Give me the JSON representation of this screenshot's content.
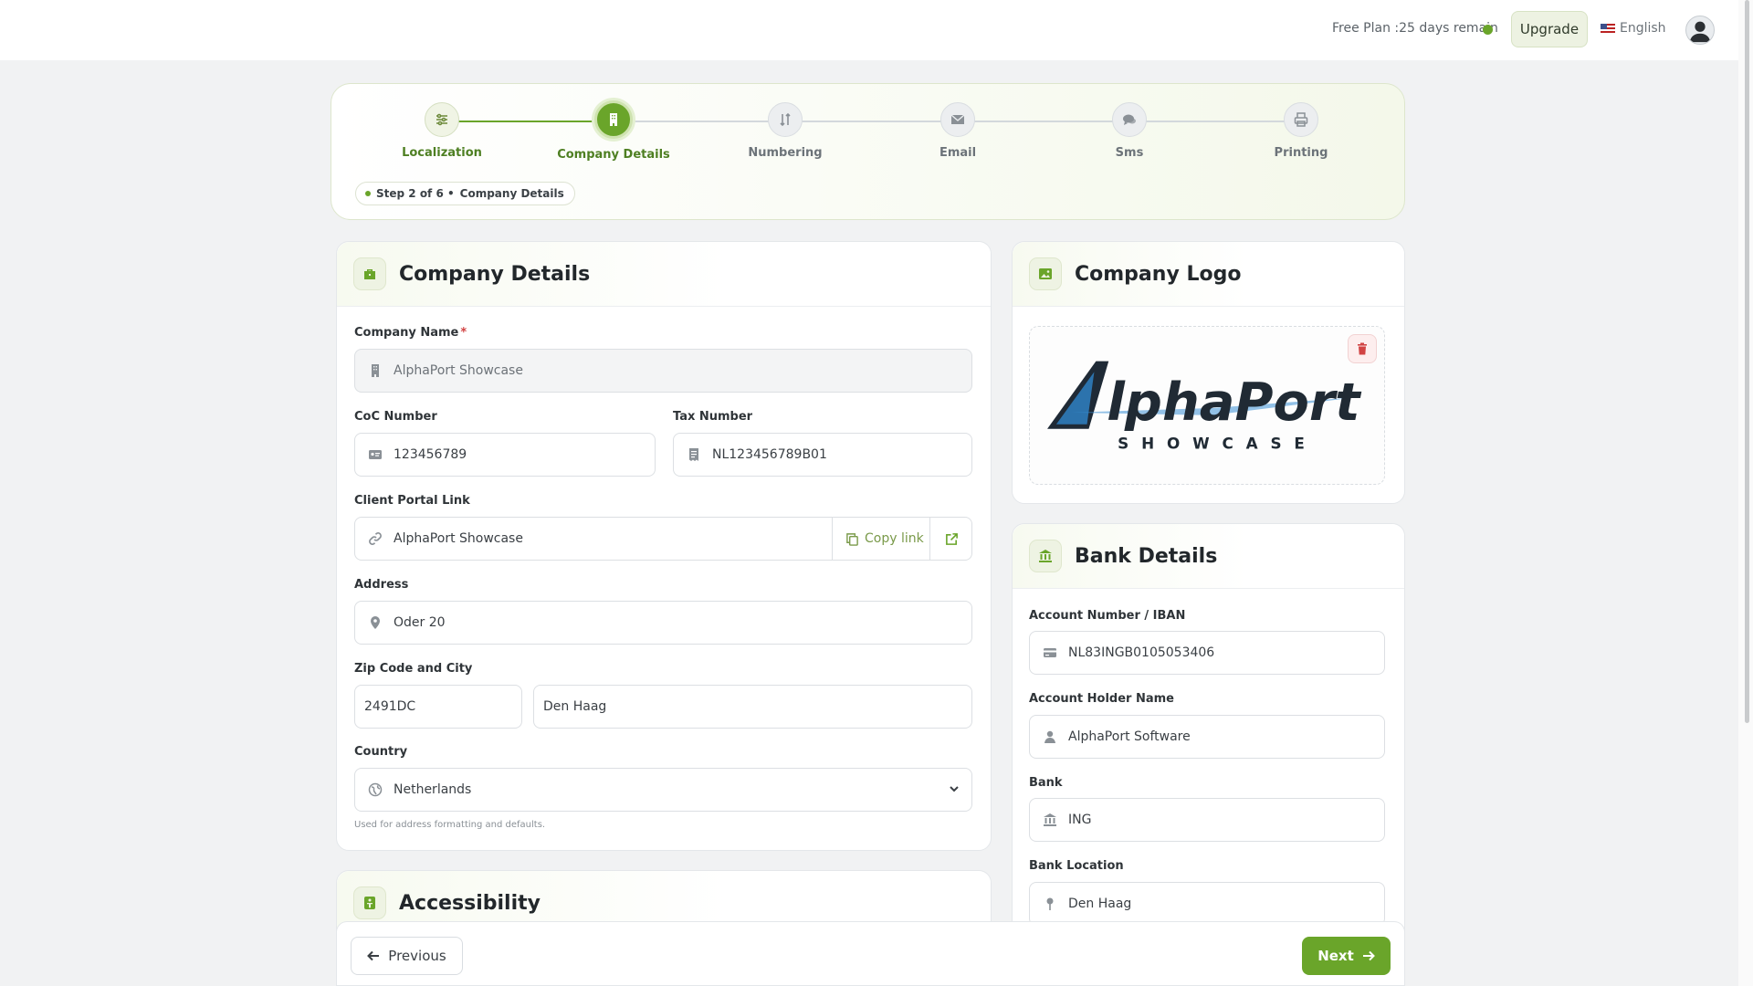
{
  "topbar": {
    "plan_text": "Free Plan :25 days remain",
    "status_color": "#6aa52a",
    "upgrade_label": "Upgrade",
    "language": "English"
  },
  "stepper": {
    "steps": [
      {
        "label": "Localization",
        "icon": "sliders-icon",
        "state": "complete"
      },
      {
        "label": "Company Details",
        "icon": "building-icon",
        "state": "active"
      },
      {
        "label": "Numbering",
        "icon": "sort-icon",
        "state": "pending"
      },
      {
        "label": "Email",
        "icon": "envelope-icon",
        "state": "pending"
      },
      {
        "label": "Sms",
        "icon": "chat-icon",
        "state": "pending"
      },
      {
        "label": "Printing",
        "icon": "printer-icon",
        "state": "pending"
      }
    ],
    "pill_step": "Step 2 of 6 •",
    "pill_name": "Company Details"
  },
  "company_details": {
    "title": "Company Details",
    "company_name_label": "Company Name",
    "required_mark": "*",
    "company_name_value": "AlphaPort Showcase",
    "coc_label": "CoC Number",
    "coc_value": "123456789",
    "tax_label": "Tax Number",
    "tax_value": "NL123456789B01",
    "portal_label": "Client Portal Link",
    "portal_value": "AlphaPort Showcase",
    "copy_label": "Copy link",
    "address_label": "Address",
    "address_value": "Oder 20",
    "zip_city_label": "Zip Code and City",
    "zip_value": "2491DC",
    "city_value": "Den Haag",
    "country_label": "Country",
    "country_value": "Netherlands",
    "country_hint": "Used for address formatting and defaults."
  },
  "accessibility": {
    "title": "Accessibility"
  },
  "company_logo": {
    "title": "Company Logo",
    "logo_word": "AlphaPort",
    "logo_sub": "SHOWCASE"
  },
  "bank_details": {
    "title": "Bank Details",
    "iban_label": "Account Number / IBAN",
    "iban_value": "NL83INGB0105053406",
    "holder_label": "Account Holder Name",
    "holder_value": "AlphaPort Software",
    "bank_label": "Bank",
    "bank_value": "ING",
    "location_label": "Bank Location",
    "location_value": "Den Haag"
  },
  "footer": {
    "previous_label": "Previous",
    "next_label": "Next"
  },
  "colors": {
    "accent": "#6aa52a",
    "danger": "#d14343"
  }
}
